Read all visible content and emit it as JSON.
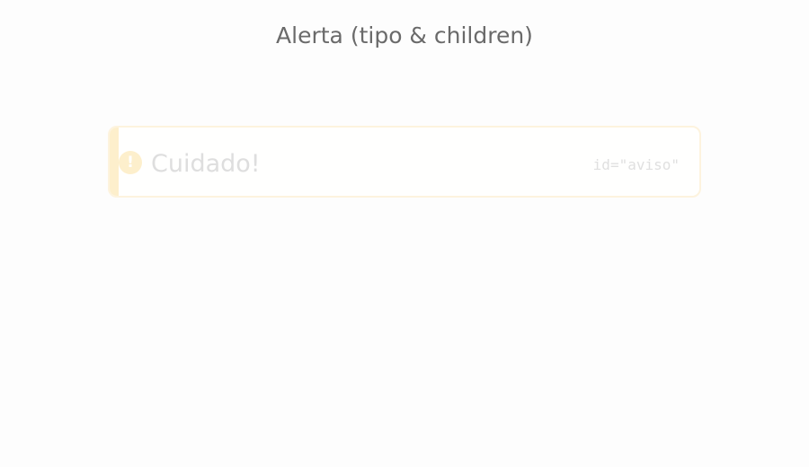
{
  "page": {
    "title": "Alerta (tipo & children)"
  },
  "alert": {
    "type": "warning",
    "icon": "exclamation-icon",
    "icon_glyph": "!",
    "message": "Cuidado!",
    "id_label": "id=\"aviso\"",
    "colors": {
      "accent": "#fdefcc",
      "border": "#fdf3de",
      "message_text": "#dedede"
    }
  }
}
